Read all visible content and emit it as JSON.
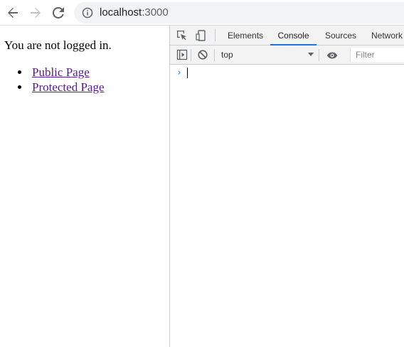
{
  "browser": {
    "url_host": "localhost",
    "url_port": ":3000",
    "icons": {
      "back": "arrow-left-icon",
      "forward": "arrow-right-icon",
      "reload": "reload-icon",
      "site_info": "info-icon"
    }
  },
  "page": {
    "status": "You are not logged in.",
    "links": [
      {
        "label": "Public Page"
      },
      {
        "label": "Protected Page"
      }
    ]
  },
  "devtools": {
    "tabs": [
      {
        "label": "Elements",
        "active": false
      },
      {
        "label": "Console",
        "active": true
      },
      {
        "label": "Sources",
        "active": false
      },
      {
        "label": "Network",
        "active": false
      }
    ],
    "console_toolbar": {
      "context": "top",
      "filter_placeholder": "Filter"
    },
    "prompt_symbol": "›",
    "colors": {
      "accent": "#1a73e8",
      "link_visited": "#551a8b",
      "toolbar_bg": "#f3f3f3"
    }
  }
}
